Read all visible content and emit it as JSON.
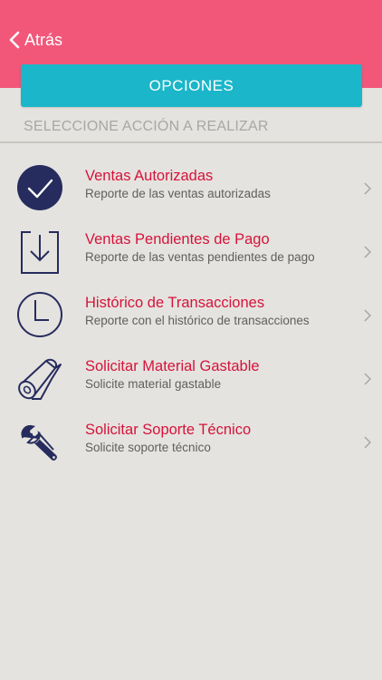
{
  "header": {
    "back_label": "Atrás",
    "options_label": "OPCIONES",
    "section_label": "SELECCIONE ACCIÓN A REALIZAR"
  },
  "colors": {
    "header_bg": "#f2577a",
    "button_bg": "#1bb6c9",
    "title_red": "#d6133b",
    "icon_navy": "#262c5e",
    "background": "#e5e3df"
  },
  "menu": {
    "items": [
      {
        "icon": "checkmark-circle-icon",
        "title": "Ventas Autorizadas",
        "subtitle": "Reporte de las ventas autorizadas"
      },
      {
        "icon": "download-tray-icon",
        "title": "Ventas Pendientes de Pago",
        "subtitle": "Reporte de las ventas pendientes de pago"
      },
      {
        "icon": "clock-icon",
        "title": "Histórico de Transacciones",
        "subtitle": "Reporte con el histórico de transacciones"
      },
      {
        "icon": "paper-roll-icon",
        "title": "Solicitar Material Gastable",
        "subtitle": "Solicite material gastable"
      },
      {
        "icon": "wrench-icon",
        "title": "Solicitar Soporte Técnico",
        "subtitle": "Solicite soporte técnico"
      }
    ]
  }
}
